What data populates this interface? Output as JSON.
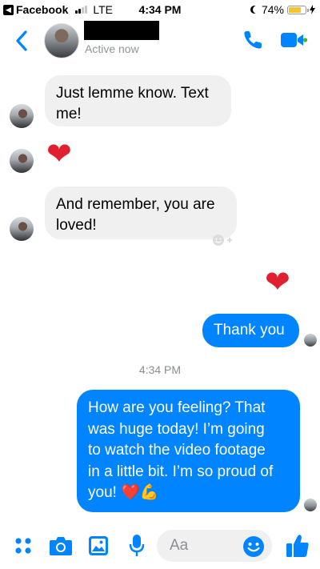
{
  "status_bar": {
    "back_app": "Facebook",
    "network": "LTE",
    "time": "4:34 PM",
    "battery": "74%",
    "battery_level": 0.74,
    "signal_bars": 2
  },
  "header": {
    "contact_name": "[redacted]",
    "presence": "Active now",
    "icons": [
      "chevron-left-icon",
      "phone-icon",
      "video-camera-icon"
    ]
  },
  "messages": [
    {
      "from": "them",
      "text": "Just lemme know. Text me!"
    },
    {
      "from": "them",
      "emoji": "❤️"
    },
    {
      "from": "them",
      "text": "And remember, you are loved!"
    },
    {
      "from": "me",
      "emoji": "❤️"
    },
    {
      "from": "me",
      "text": "Thank you"
    },
    {
      "from": "me",
      "text": "How are you feeling? That was huge today! I’m going to watch the video footage in a little bit. I’m so proud of you! ❤️💪"
    }
  ],
  "lines": {
    "m1_l1": "Just lemme know. Text",
    "m1_l2": "me!",
    "m3_l1": "And remember, you are",
    "m3_l2": "loved!",
    "m6_l1": "How are you feeling? That",
    "m6_l2": "was huge today! I’m going",
    "m6_l3": "to watch the video footage",
    "m6_l4": "in a little bit. I’m so proud of",
    "m6_l5": "you! ❤️💪"
  },
  "heart": "❤",
  "timestamp": "4:34 PM",
  "composer": {
    "placeholder": "Aa",
    "icons": [
      "more-dots-icon",
      "camera-icon",
      "photo-icon",
      "microphone-icon",
      "emoji-icon",
      "thumbs-up-icon"
    ]
  },
  "colors": {
    "accent": "#0084ff",
    "incoming_bubble": "#f1f0f0",
    "heart": "#e0202e"
  }
}
